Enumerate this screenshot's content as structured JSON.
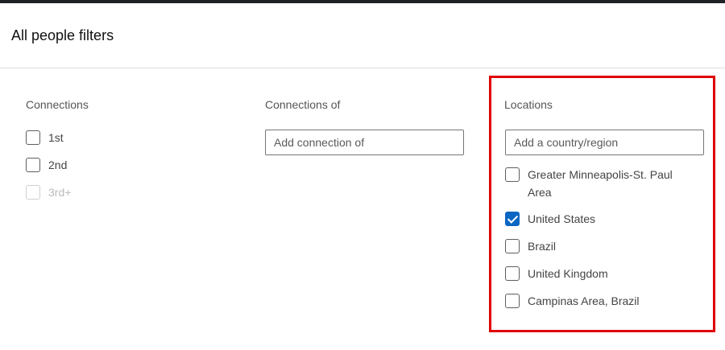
{
  "header": {
    "title": "All people filters"
  },
  "connections": {
    "label": "Connections",
    "items": [
      {
        "label": "1st",
        "checked": false,
        "disabled": false
      },
      {
        "label": "2nd",
        "checked": false,
        "disabled": false
      },
      {
        "label": "3rd+",
        "checked": false,
        "disabled": true
      }
    ]
  },
  "connections_of": {
    "label": "Connections of",
    "placeholder": "Add connection of"
  },
  "locations": {
    "label": "Locations",
    "placeholder": "Add a country/region",
    "items": [
      {
        "label_line1": "Greater Minneapolis-St. Paul",
        "label_line2": "Area",
        "checked": false
      },
      {
        "label": "United States",
        "checked": true
      },
      {
        "label": "Brazil",
        "checked": false
      },
      {
        "label": "United Kingdom",
        "checked": false
      },
      {
        "label": "Campinas Area, Brazil",
        "checked": false
      }
    ]
  },
  "colors": {
    "accent": "#0a66c2",
    "highlight": "#e00000"
  }
}
